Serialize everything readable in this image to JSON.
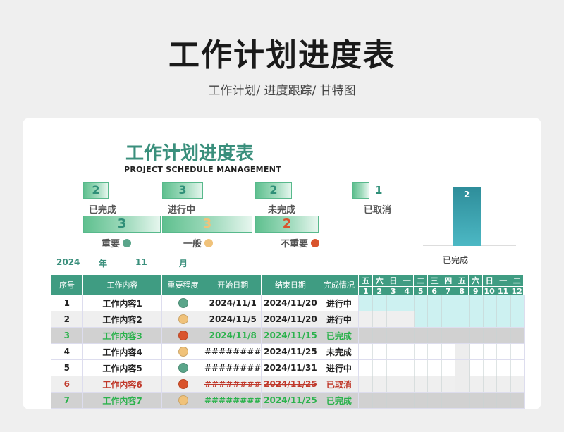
{
  "header": {
    "title": "工作计划进度表",
    "subtitle": "工作计划/  进度跟踪/  甘特图"
  },
  "sheet": {
    "title": "工作计划进度表",
    "subtitle": "PROJECT SCHEDULE MANAGEMENT"
  },
  "stats": [
    {
      "value": "2",
      "label": "已完成"
    },
    {
      "value": "3",
      "label": "进行中"
    },
    {
      "value": "2",
      "label": "未完成"
    },
    {
      "value": "1",
      "label": "已取消"
    }
  ],
  "importance": [
    {
      "value": "3",
      "label": "重要",
      "color": "#5aa58a"
    },
    {
      "value": "3",
      "label": "一般",
      "color": "#f0c27a"
    },
    {
      "value": "2",
      "label": "不重要",
      "color": "#d9532c"
    }
  ],
  "chart_data": {
    "type": "bar",
    "categories": [
      "已完成"
    ],
    "values": [
      2
    ],
    "value_labels": [
      "2"
    ],
    "ylim": [
      0,
      2.2
    ]
  },
  "date": {
    "year": "2024",
    "year_unit": "年",
    "month": "11",
    "month_unit": "月"
  },
  "table": {
    "headers": [
      "序号",
      "工作内容",
      "重要程度",
      "开始日期",
      "结束日期",
      "完成情况"
    ],
    "days": [
      {
        "weekday": "五",
        "num": "1"
      },
      {
        "weekday": "六",
        "num": "2"
      },
      {
        "weekday": "日",
        "num": "3"
      },
      {
        "weekday": "一",
        "num": "4"
      },
      {
        "weekday": "二",
        "num": "5"
      },
      {
        "weekday": "三",
        "num": "6"
      },
      {
        "weekday": "四",
        "num": "7"
      },
      {
        "weekday": "五",
        "num": "8"
      },
      {
        "weekday": "六",
        "num": "9"
      },
      {
        "weekday": "日",
        "num": "10"
      },
      {
        "weekday": "一",
        "num": "11"
      },
      {
        "weekday": "二",
        "num": "12"
      }
    ],
    "rows": [
      {
        "seq": "1",
        "name": "工作内容1",
        "importance_color": "#5aa58a",
        "start": "2024/11/1",
        "end": "2024/11/20",
        "status": "进行中",
        "fill_start": 1,
        "fill_end": 12,
        "style": ""
      },
      {
        "seq": "2",
        "name": "工作内容2",
        "importance_color": "#f0c27a",
        "start": "2024/11/5",
        "end": "2024/11/20",
        "status": "进行中",
        "fill_start": 5,
        "fill_end": 12,
        "style": "alt"
      },
      {
        "seq": "3",
        "name": "工作内容3",
        "importance_color": "#d9532c",
        "start": "2024/11/8",
        "end": "2024/11/15",
        "status": "已完成",
        "fill_start": 0,
        "fill_end": 0,
        "style": "gray done"
      },
      {
        "seq": "4",
        "name": "工作内容4",
        "importance_color": "#f0c27a",
        "start": "########",
        "end": "2024/11/25",
        "status": "未完成",
        "fill_start": 0,
        "fill_end": 0,
        "style": ""
      },
      {
        "seq": "5",
        "name": "工作内容5",
        "importance_color": "#5aa58a",
        "start": "########",
        "end": "2024/11/31",
        "status": "进行中",
        "fill_start": 0,
        "fill_end": 0,
        "style": ""
      },
      {
        "seq": "6",
        "name": "工作内容6",
        "importance_color": "#d9532c",
        "start": "########",
        "end": "2024/11/25",
        "status": "已取消",
        "fill_start": 0,
        "fill_end": 0,
        "style": "alt cancel"
      },
      {
        "seq": "7",
        "name": "工作内容7",
        "importance_color": "#f0c27a",
        "start": "########",
        "end": "2024/11/25",
        "status": "已完成",
        "fill_start": 0,
        "fill_end": 0,
        "style": "gray done"
      }
    ]
  }
}
